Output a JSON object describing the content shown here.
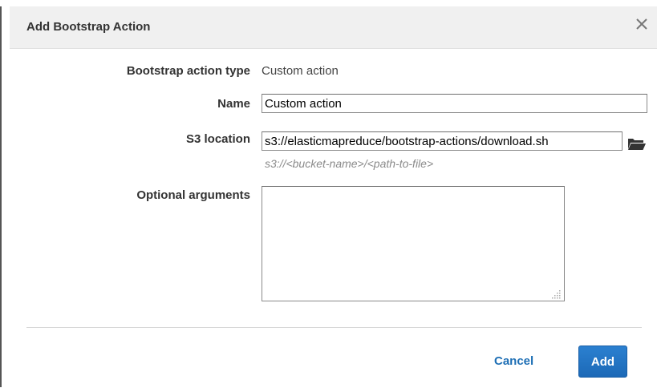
{
  "dialog": {
    "title": "Add Bootstrap Action",
    "close_icon": "close-icon"
  },
  "form": {
    "action_type": {
      "label": "Bootstrap action type",
      "value": "Custom action"
    },
    "name": {
      "label": "Name",
      "value": "Custom action"
    },
    "s3_location": {
      "label": "S3 location",
      "value": "s3://elasticmapreduce/bootstrap-actions/download.sh",
      "hint": "s3://<bucket-name>/<path-to-file>",
      "browse_icon": "folder-open-icon"
    },
    "optional_arguments": {
      "label": "Optional arguments",
      "value": ""
    }
  },
  "footer": {
    "cancel_label": "Cancel",
    "add_label": "Add"
  },
  "colors": {
    "header_bg": "#f0f0f0",
    "link_blue": "#1e6fb5",
    "primary_button": "#2476c4",
    "hint_gray": "#8a8a8a"
  }
}
